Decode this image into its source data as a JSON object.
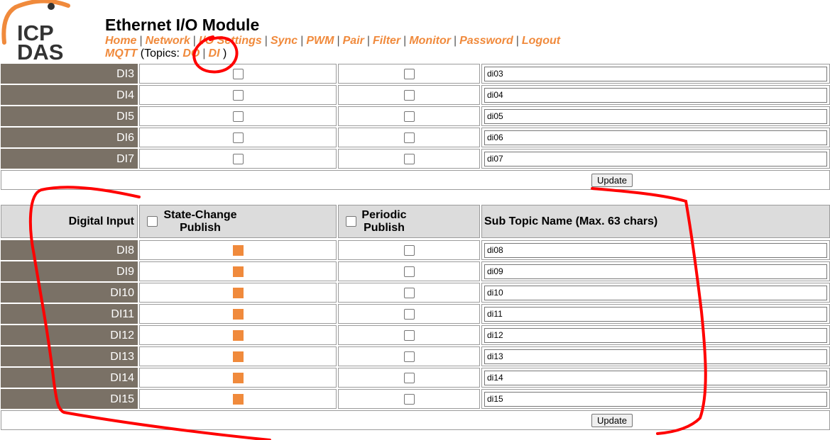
{
  "header": {
    "title": "Ethernet I/O Module",
    "logo_text": [
      "ICP",
      "DAS"
    ],
    "nav": [
      "Home",
      "Network",
      "I/O Settings",
      "Sync",
      "PWM",
      "Pair",
      "Filter",
      "Monitor",
      "Password",
      "Logout"
    ],
    "mqtt": {
      "label": "MQTT",
      "topics_prefix": "(Topics: ",
      "topics": [
        "DO",
        "DI"
      ],
      "topics_suffix": ")"
    }
  },
  "table1": {
    "rows": [
      {
        "name": "DI3",
        "state_change": false,
        "periodic": false,
        "sub_topic": "di03"
      },
      {
        "name": "DI4",
        "state_change": false,
        "periodic": false,
        "sub_topic": "di04"
      },
      {
        "name": "DI5",
        "state_change": false,
        "periodic": false,
        "sub_topic": "di05"
      },
      {
        "name": "DI6",
        "state_change": false,
        "periodic": false,
        "sub_topic": "di06"
      },
      {
        "name": "DI7",
        "state_change": false,
        "periodic": false,
        "sub_topic": "di07"
      }
    ],
    "update_label": "Update"
  },
  "table2": {
    "headers": {
      "name": "Digital Input",
      "state_change": [
        "State-Change",
        "Publish"
      ],
      "periodic": [
        "Periodic",
        "Publish"
      ],
      "sub_topic": "Sub Topic Name (Max. 63 chars)"
    },
    "rows": [
      {
        "name": "DI8",
        "state_change": true,
        "periodic": false,
        "sub_topic": "di08"
      },
      {
        "name": "DI9",
        "state_change": true,
        "periodic": false,
        "sub_topic": "di09"
      },
      {
        "name": "DI10",
        "state_change": true,
        "periodic": false,
        "sub_topic": "di10"
      },
      {
        "name": "DI11",
        "state_change": true,
        "periodic": false,
        "sub_topic": "di11"
      },
      {
        "name": "DI12",
        "state_change": true,
        "periodic": false,
        "sub_topic": "di12"
      },
      {
        "name": "DI13",
        "state_change": true,
        "periodic": false,
        "sub_topic": "di13"
      },
      {
        "name": "DI14",
        "state_change": true,
        "periodic": false,
        "sub_topic": "di14"
      },
      {
        "name": "DI15",
        "state_change": true,
        "periodic": false,
        "sub_topic": "di15"
      }
    ],
    "update_label": "Update"
  },
  "colors": {
    "accent": "#f08a3c",
    "name_cell": "#7a7166",
    "header_bg": "#dcdcdc",
    "annotation": "#ff0000"
  }
}
